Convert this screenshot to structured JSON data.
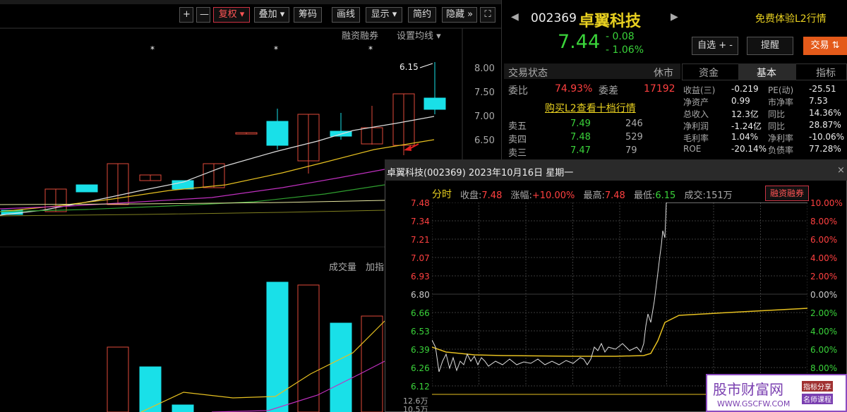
{
  "toolbar": {
    "items": [
      "+",
      "—",
      "复权 ▾",
      "叠加 ▾",
      "筹码",
      "画线",
      "显示 ▾",
      "简约",
      "隐藏 »"
    ],
    "fullscreen": "⛶"
  },
  "chart_top": {
    "info_left": "融资融券",
    "info_right": "设置均线 ▾",
    "price_ticks": [
      "8.00",
      "7.50",
      "7.00",
      "6.50"
    ],
    "peak_label": "6.15",
    "vol_label": "成交量",
    "vol_label2": "加指"
  },
  "quote": {
    "code": "002369",
    "name": "卓翼科技",
    "price": "7.44",
    "change": "0.08",
    "pct": "1.06%",
    "btn_add": "自选 + -",
    "btn_alert": "提醒",
    "btn_trade": "交易 ⇅",
    "free_trial": "免费体验L2行情",
    "trade_status": "交易状态",
    "status_val": "休市",
    "wei_bi_label": "委比",
    "wei_bi": "74.93%",
    "wei_cha_label": "委差",
    "wei_cha": "17192",
    "l2_link": "购买L2查看十档行情",
    "tabs": [
      "资金",
      "基本",
      "指标"
    ],
    "asks": [
      {
        "l": "卖五",
        "p": "7.49",
        "v": "246"
      },
      {
        "l": "卖四",
        "p": "7.48",
        "v": "529"
      },
      {
        "l": "卖三",
        "p": "7.47",
        "v": "79"
      }
    ],
    "fund": [
      {
        "a": "收益(三)",
        "b": "-0.219",
        "c": "PE(动)",
        "d": "-25.51"
      },
      {
        "a": "净资产",
        "b": "0.99",
        "c": "市净率",
        "d": "7.53"
      },
      {
        "a": "总收入",
        "b": "12.3亿",
        "c": "同比",
        "d": "14.36%"
      },
      {
        "a": "净利润",
        "b": "-1.24亿",
        "c": "同比",
        "d": "28.87%"
      },
      {
        "a": "毛利率",
        "b": "1.04%",
        "c": "净利率",
        "d": "-10.06%"
      },
      {
        "a": "ROE",
        "b": "-20.14%",
        "c": "负债率",
        "d": "77.28%"
      }
    ]
  },
  "popup": {
    "title": "卓翼科技(002369) 2023年10月16日 星期一",
    "tab": "分时",
    "close_label": "收盘:",
    "close": "7.48",
    "rise_label": "涨幅:",
    "rise": "+10.00%",
    "high_label": "最高:",
    "high": "7.48",
    "low_label": "最低:",
    "low": "6.15",
    "vol_label": "成交:",
    "vol": "151万",
    "btn": "融资融券",
    "left_ticks": [
      "7.48",
      "7.34",
      "7.21",
      "7.07",
      "6.93",
      "6.80",
      "6.66",
      "6.53",
      "6.39",
      "6.26",
      "6.12"
    ],
    "right_ticks": [
      "10.00%",
      "8.00%",
      "6.00%",
      "4.00%",
      "2.00%",
      "0.00%",
      "2.00%",
      "4.00%",
      "6.00%",
      "8.00%"
    ],
    "vol_tick": "12.6万",
    "vol_tick2": "10.5万"
  },
  "watermark": {
    "name": "股市财富网",
    "tag1": "指标分享",
    "tag2": "名师课程",
    "url": "WWW.GSCFW.COM"
  }
}
